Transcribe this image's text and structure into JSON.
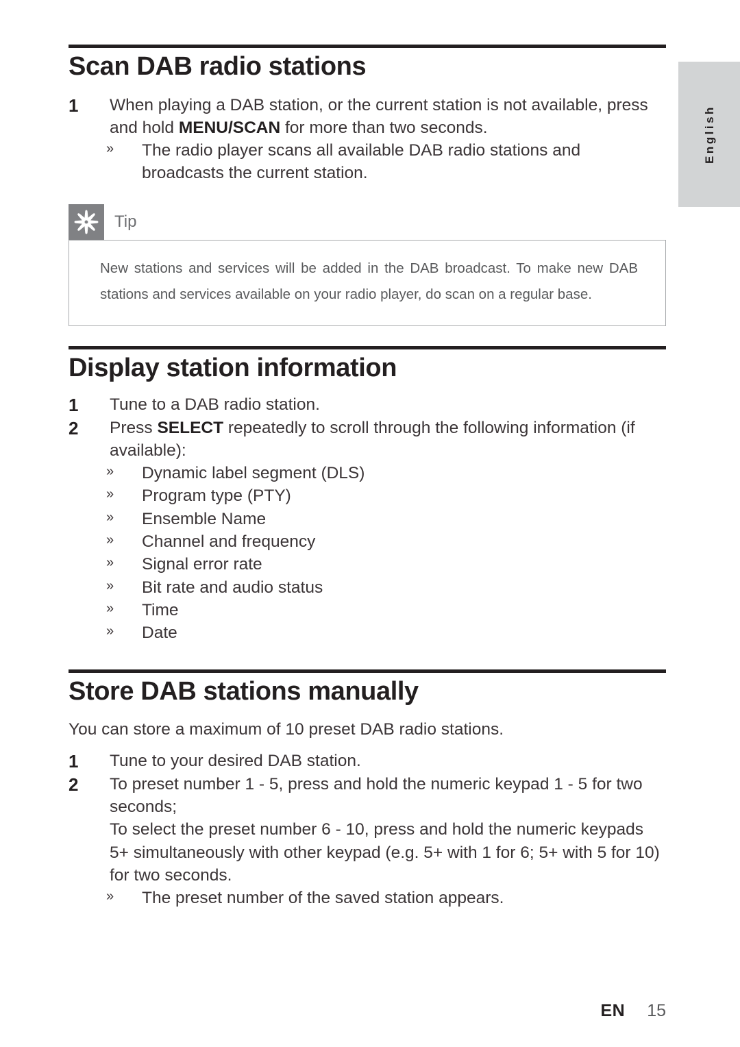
{
  "side_tab": {
    "language": "English"
  },
  "sections": [
    {
      "id": "scan-dab-radio-stations",
      "heading": "Scan DAB radio stations",
      "steps": [
        {
          "number": "1",
          "text_before": "When playing a DAB station, or the current station is not available, press and hold ",
          "bold": "MENU/SCAN",
          "text_after": " for more than two seconds."
        }
      ],
      "sub_bullets": [
        {
          "marker": "»",
          "text": "The radio player scans all available DAB radio stations and broadcasts the current station."
        }
      ],
      "tip": {
        "icon": "tip-asterisk-icon",
        "label": "Tip",
        "body": "New stations and services will be added in the DAB broadcast. To make new DAB stations and services available on your radio player, do scan on a regular base."
      }
    },
    {
      "id": "display-station-information",
      "heading": "Display station information",
      "steps": [
        {
          "number": "1",
          "text_before": "Tune to a DAB radio station.",
          "bold": "",
          "text_after": ""
        },
        {
          "number": "2",
          "text_before": "Press ",
          "bold": "SELECT",
          "text_after": " repeatedly to scroll through the following information (if available):"
        }
      ],
      "bullet_list": [
        {
          "marker": "»",
          "text": "Dynamic label segment (DLS)"
        },
        {
          "marker": "»",
          "text": "Program type (PTY)"
        },
        {
          "marker": "»",
          "text": "Ensemble Name"
        },
        {
          "marker": "»",
          "text": "Channel and frequency"
        },
        {
          "marker": "»",
          "text": "Signal error rate"
        },
        {
          "marker": "»",
          "text": "Bit rate and audio status"
        },
        {
          "marker": "»",
          "text": "Time"
        },
        {
          "marker": "»",
          "text": "Date"
        }
      ]
    },
    {
      "id": "store-dab-stations-manually",
      "heading": "Store DAB stations manually",
      "intro": "You can store a maximum of 10 preset DAB radio stations.",
      "steps": [
        {
          "number": "1",
          "text": "Tune to your desired DAB station."
        },
        {
          "number": "2",
          "paragraphs": [
            "To preset number 1 - 5, press and hold the numeric keypad 1 - 5 for two seconds;",
            "To select the preset number 6 - 10, press and hold the numeric keypads 5+ simultaneously with other keypad (e.g. 5+ with 1 for 6; 5+ with 5 for 10) for two seconds."
          ]
        }
      ],
      "sub_bullets": [
        {
          "marker": "»",
          "text": "The preset number of the saved station appears."
        }
      ]
    }
  ],
  "footer": {
    "language_code": "EN",
    "page_number": "15"
  },
  "colors": {
    "heading": "#231f20",
    "body": "#3b3537",
    "tip_tab": "#808184",
    "tip_border": "#a7a9ac",
    "side_tab_bg": "#d2d4d5"
  }
}
